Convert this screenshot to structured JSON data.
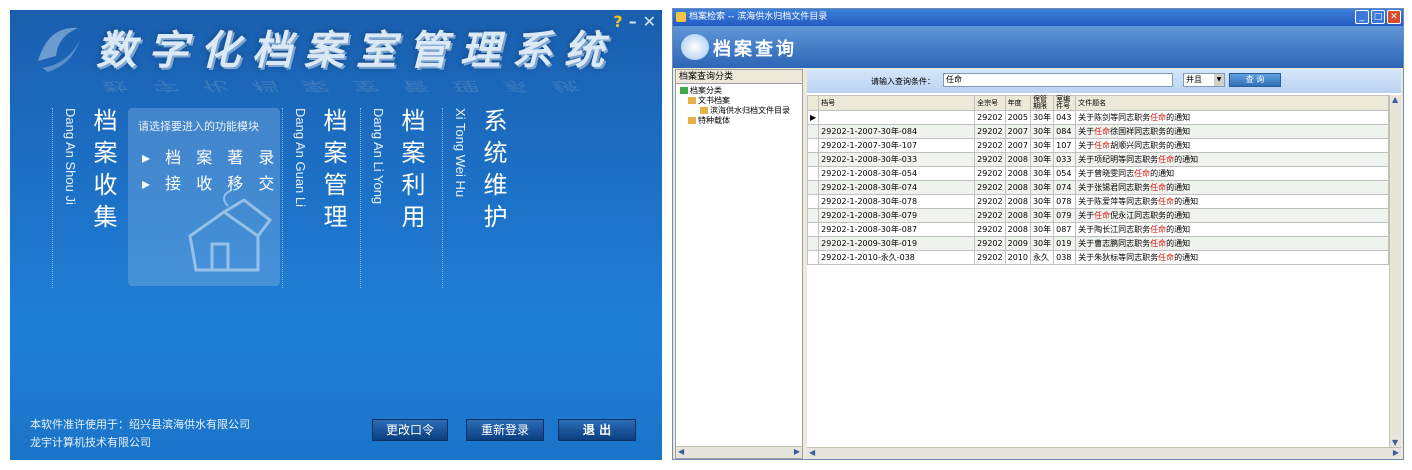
{
  "left_panel": {
    "title": "数字化档案室管理系统",
    "controls": {
      "help": "?",
      "minimize": "–",
      "close": "✕"
    },
    "columns": [
      {
        "pinyin": "Dang An Shou Ji",
        "label": "档案收集"
      },
      {
        "pinyin": "Dang An Guan Li",
        "label": "档案管理"
      },
      {
        "pinyin": "Dang An Li Yong",
        "label": "档案利用"
      },
      {
        "pinyin": "Xi Tong Wei Hu",
        "label": "系统维护"
      }
    ],
    "module_box": {
      "hint": "请选择要进入的功能模块",
      "options": [
        "▸ 档 案 著 录",
        "▸ 接 收 移 交"
      ]
    },
    "license": {
      "line1": "本软件准许使用于：绍兴县滨海供水有限公司",
      "line2": "龙宇计算机技术有限公司"
    },
    "buttons": {
      "change_password": "更改口令",
      "relogin": "重新登录",
      "exit": "退  出"
    }
  },
  "right_window": {
    "title": "档案检索  --  滨海供水归档文件目录",
    "banner_title": "档案查询",
    "tree": {
      "header": "档案查询分类",
      "nodes": [
        "档案分类",
        "文书档案",
        "滨海供水归档文件目录",
        "特种载体"
      ]
    },
    "query": {
      "label": "请输入查询条件：",
      "value": "任命",
      "logic": "并且",
      "search_button": "查  询"
    },
    "grid": {
      "columns": [
        "档号",
        "全宗号",
        "年度",
        "保管期限",
        "室编件号",
        "文件题名"
      ],
      "rows": [
        {
          "id": "",
          "fonds": "29202",
          "year": "2005",
          "period": "30年",
          "num": "043",
          "pre": "关于陈剑等同志职务",
          "mid": "任命",
          "post": "的通知"
        },
        {
          "id": "29202-1-2007-30年-084",
          "fonds": "29202",
          "year": "2007",
          "period": "30年",
          "num": "084",
          "pre": "关于",
          "mid": "任命",
          "post": "徐国祥同志职务的通知"
        },
        {
          "id": "29202-1-2007-30年-107",
          "fonds": "29202",
          "year": "2007",
          "period": "30年",
          "num": "107",
          "pre": "关于",
          "mid": "任命",
          "post": "胡顺兴同志职务的通知"
        },
        {
          "id": "29202-1-2008-30年-033",
          "fonds": "29202",
          "year": "2008",
          "period": "30年",
          "num": "033",
          "pre": "关于项纪明等同志职务",
          "mid": "任命",
          "post": "的通知"
        },
        {
          "id": "29202-1-2008-30年-054",
          "fonds": "29202",
          "year": "2008",
          "period": "30年",
          "num": "054",
          "pre": "关于曾晓雯同志",
          "mid": "任命",
          "post": "的通知"
        },
        {
          "id": "29202-1-2008-30年-074",
          "fonds": "29202",
          "year": "2008",
          "period": "30年",
          "num": "074",
          "pre": "关于张锡君同志职务",
          "mid": "任命",
          "post": "的通知"
        },
        {
          "id": "29202-1-2008-30年-078",
          "fonds": "29202",
          "year": "2008",
          "period": "30年",
          "num": "078",
          "pre": "关于陈爱萍等同志职务",
          "mid": "任命",
          "post": "的通知"
        },
        {
          "id": "29202-1-2008-30年-079",
          "fonds": "29202",
          "year": "2008",
          "period": "30年",
          "num": "079",
          "pre": "关于",
          "mid": "任命",
          "post": "倪永江同志职务的通知"
        },
        {
          "id": "29202-1-2008-30年-087",
          "fonds": "29202",
          "year": "2008",
          "period": "30年",
          "num": "087",
          "pre": "关于陶长江同志职务",
          "mid": "任命",
          "post": "的通知"
        },
        {
          "id": "29202-1-2009-30年-019",
          "fonds": "29202",
          "year": "2009",
          "period": "30年",
          "num": "019",
          "pre": "关于曹志鹏同志职务",
          "mid": "任命",
          "post": "的通知"
        },
        {
          "id": "29202-1-2010-永久-038",
          "fonds": "29202",
          "year": "2010",
          "period": "永久",
          "num": "038",
          "pre": "关于朱狄标等同志职务",
          "mid": "任命",
          "post": "的通知"
        }
      ]
    }
  }
}
